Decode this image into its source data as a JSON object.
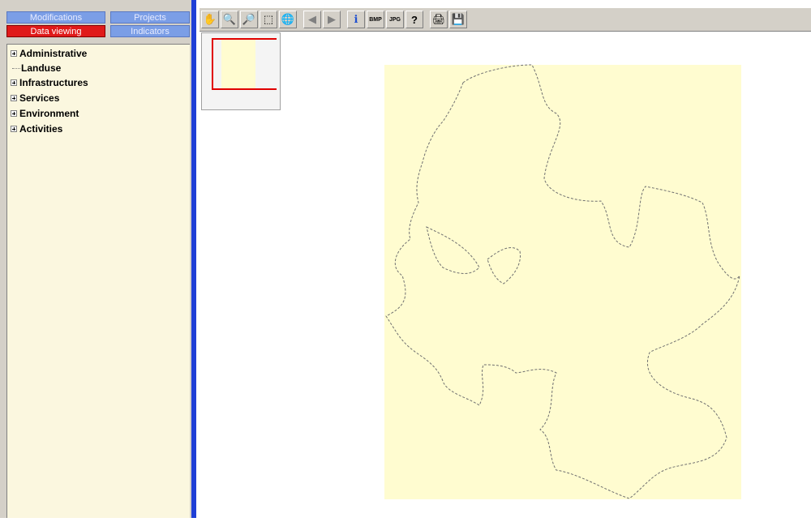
{
  "tabs": {
    "modifications": "Modifications",
    "projects": "Projects",
    "data_viewing": "Data viewing",
    "indicators": "Indicators"
  },
  "tree": {
    "items": [
      {
        "label": "Administrative",
        "expandable": true
      },
      {
        "label": "Landuse",
        "expandable": false
      },
      {
        "label": "Infrastructures",
        "expandable": true
      },
      {
        "label": "Services",
        "expandable": true
      },
      {
        "label": "Environment",
        "expandable": true
      },
      {
        "label": "Activities",
        "expandable": true
      }
    ]
  },
  "toolbar": {
    "buttons": [
      "pan-icon",
      "zoom-in-icon",
      "zoom-out-icon",
      "zoom-window-icon",
      "full-extent-icon",
      "back-icon",
      "forward-icon",
      "info-icon",
      "export-bmp-icon",
      "export-jpg-icon",
      "help-icon",
      "print-icon",
      "save-icon"
    ]
  },
  "colors": {
    "active_tab": "#e01a1a",
    "inactive_tab": "#7b9ee6",
    "panel_bg": "#fbf7df",
    "map_fill": "#fffcd0",
    "splitter": "#1f3fd6"
  }
}
